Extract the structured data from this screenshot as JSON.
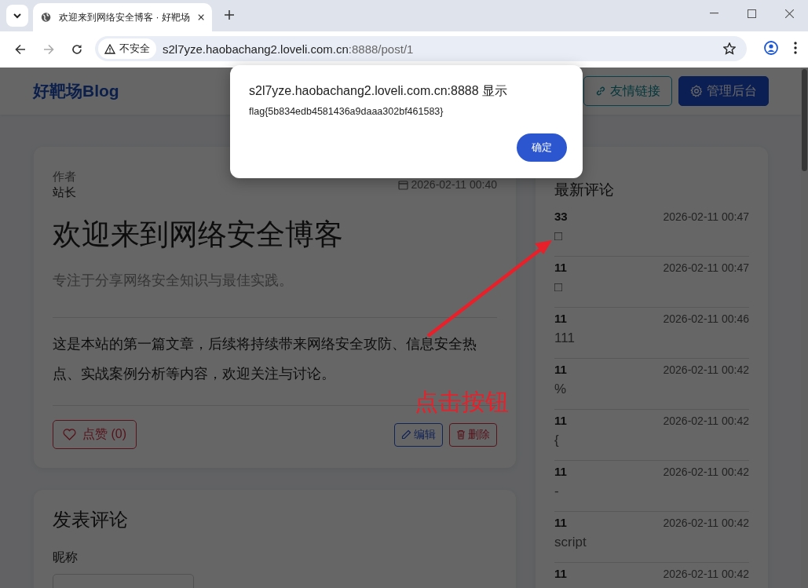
{
  "browser": {
    "tab_title": "欢迎来到网络安全博客 · 好靶场",
    "security_label": "不安全",
    "url": {
      "host": "s2l7yze.haobachang2.loveli.com.cn",
      "path": ":8888/post/1"
    }
  },
  "site": {
    "logo": "好靶场Blog",
    "nav": [
      {
        "label": "友情链接",
        "kind": "outline"
      },
      {
        "label": "管理后台",
        "kind": "primary"
      }
    ]
  },
  "post": {
    "author_label": "作者",
    "author": "站长",
    "date": "2026-02-11 00:40",
    "title": "欢迎来到网络安全博客",
    "subtitle": "专注于分享网络安全知识与最佳实践。",
    "body": "这是本站的第一篇文章，后续将持续带来网络安全攻防、信息安全热点、实战案例分析等内容，欢迎关注与讨论。",
    "like": "点赞 (0)",
    "actions": [
      {
        "label": "编辑",
        "kind": "edit"
      },
      {
        "label": "删除",
        "kind": "delete"
      }
    ]
  },
  "comment_form": {
    "title": "发表评论",
    "fields": [
      {
        "label": "昵称"
      }
    ]
  },
  "recent_comments": {
    "title": "最新评论",
    "items": [
      {
        "name": "33",
        "time": "2026-02-11 00:47",
        "text": "□"
      },
      {
        "name": "11",
        "time": "2026-02-11 00:47",
        "text": "□"
      },
      {
        "name": "11",
        "time": "2026-02-11 00:46",
        "text": "111"
      },
      {
        "name": "11",
        "time": "2026-02-11 00:42",
        "text": "%"
      },
      {
        "name": "11",
        "time": "2026-02-11 00:42",
        "text": "{"
      },
      {
        "name": "11",
        "time": "2026-02-11 00:42",
        "text": "-"
      },
      {
        "name": "11",
        "time": "2026-02-11 00:42",
        "text": "script"
      },
      {
        "name": "11",
        "time": "2026-02-11 00:42"
      }
    ]
  },
  "dialog": {
    "title": "s2l7yze.haobachang2.loveli.com.cn:8888 显示",
    "message": "flag{5b834edb4581436a9daaa302bf461583}",
    "button": "确定"
  },
  "annotation": {
    "text": "点击按钮"
  }
}
